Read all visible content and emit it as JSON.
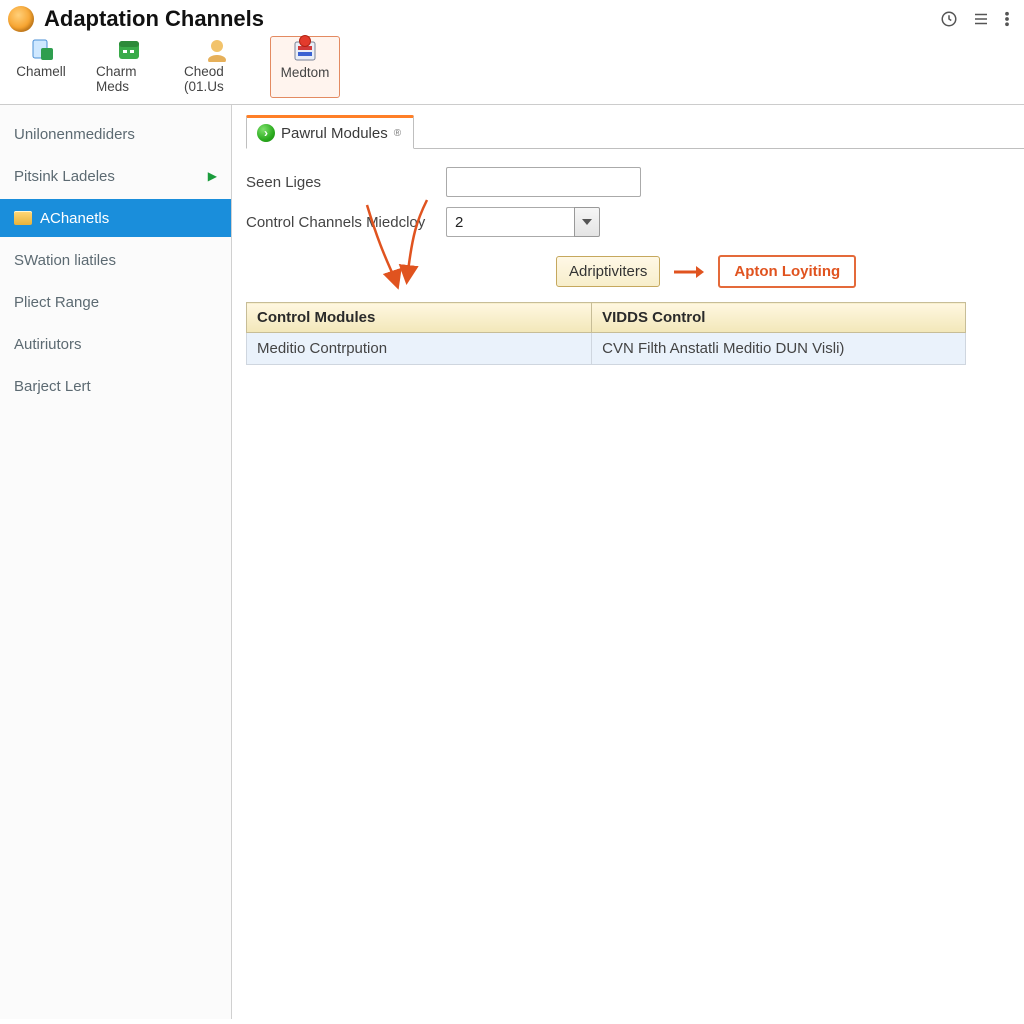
{
  "header": {
    "title": "Adaptation Channels"
  },
  "toolbar": {
    "items": [
      {
        "label": "Chamell"
      },
      {
        "label": "Charm Meds"
      },
      {
        "label": "Cheod (01.Us"
      },
      {
        "label": "Medtom"
      }
    ]
  },
  "sidebar": {
    "items": [
      {
        "label": "Unilonenmediders"
      },
      {
        "label": "Pitsink Ladeles"
      },
      {
        "label": "AChanetls"
      },
      {
        "label": "SWation liatiles"
      },
      {
        "label": "Pliect Range"
      },
      {
        "label": "Autiriutors"
      },
      {
        "label": "Barject Lert"
      }
    ],
    "active_index": 2
  },
  "main": {
    "tab_label": "Pawrul Modules",
    "form": {
      "seen_label": "Seen Liges",
      "seen_value": "",
      "control_label": "Control Channels  Miedcloy",
      "control_value": "2"
    },
    "buttons": {
      "adrip": "Adriptiviters",
      "apton": "Apton Loyiting"
    },
    "table": {
      "headers": [
        "Control Modules",
        "VIDDS Control"
      ],
      "rows": [
        {
          "c0": "Meditio Contrpution",
          "c1": "CVN Filth Anstatli Meditio DUN Visli)"
        }
      ]
    }
  }
}
